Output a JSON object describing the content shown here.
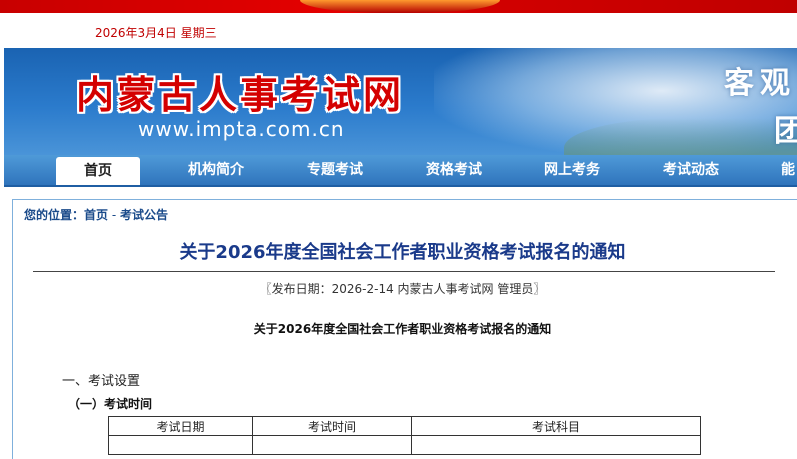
{
  "date": "2026年3月4日 星期三",
  "header": {
    "site_title": "内蒙古人事考试网",
    "site_url": "www.impta.com.cn",
    "slogan_line1": "客观",
    "slogan_line2": "团"
  },
  "nav": {
    "items": [
      {
        "label": "首页"
      },
      {
        "label": "机构简介"
      },
      {
        "label": "专题考试"
      },
      {
        "label": "资格考试"
      },
      {
        "label": "网上考务"
      },
      {
        "label": "考试动态"
      },
      {
        "label": "能"
      }
    ]
  },
  "breadcrumb": {
    "prefix": "您的位置：",
    "home": "首页",
    "separator": " - ",
    "current": "考试公告"
  },
  "article": {
    "title": "关于2026年度全国社会工作者职业资格考试报名的通知",
    "pubinfo": "〖发布日期：2026-2-14 内蒙古人事考试网 管理员〗",
    "subtitle": "关于2026年度全国社会工作者职业资格考试报名的通知",
    "section1": "一、考试设置",
    "subsection1": "（一）考试时间",
    "table": {
      "headers": [
        "考试日期",
        "考试时间",
        "考试科目"
      ]
    }
  },
  "colors": {
    "accent_red": "#d40000",
    "nav_blue": "#2f74bc",
    "title_blue": "#1a3a8a"
  }
}
